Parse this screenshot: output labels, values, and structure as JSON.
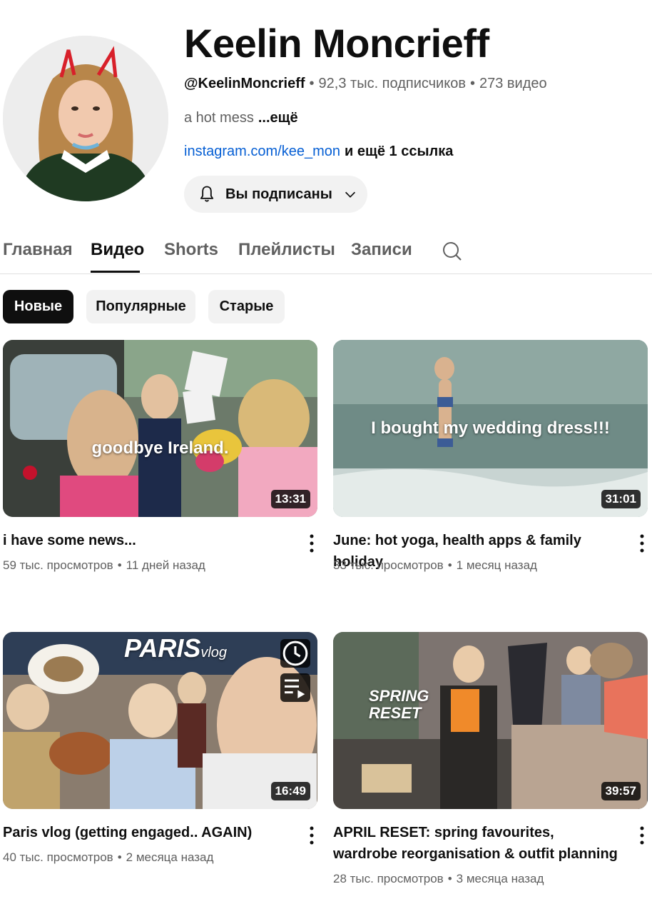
{
  "channel": {
    "name": "Keelin Moncrieff",
    "handle": "@KeelinMoncrieff",
    "subscribers": "92,3 тыс. подписчиков",
    "videos_count": "273 видео",
    "separator": "•",
    "description": "a hot mess",
    "description_more": "...ещё",
    "link": "instagram.com/kee_mon",
    "more_links": "и ещё 1 ссылка"
  },
  "subscribe_button": {
    "label": "Вы подписаны",
    "icon": "bell-icon"
  },
  "tabs": [
    {
      "label": "Главная",
      "active": false
    },
    {
      "label": "Видео",
      "active": true
    },
    {
      "label": "Shorts",
      "active": false
    },
    {
      "label": "Плейлисты",
      "active": false
    },
    {
      "label": "Записи",
      "active": false
    }
  ],
  "chips": [
    {
      "label": "Новые",
      "selected": true
    },
    {
      "label": "Популярные",
      "selected": false
    },
    {
      "label": "Старые",
      "selected": false
    }
  ],
  "videos": [
    {
      "title": "i have some news...",
      "views": "59 тыс. просмотров",
      "age": "11 дней назад",
      "duration": "13:31",
      "thumb_text": "goodbye Ireland."
    },
    {
      "title": "June: hot yoga, health apps & family holiday",
      "views": "33 тыс. просмотров",
      "age": "1 месяц назад",
      "duration": "31:01",
      "thumb_text": "I bought my wedding dress!!!"
    },
    {
      "title": "Paris vlog (getting engaged.. AGAIN)",
      "views": "40 тыс. просмотров",
      "age": "2 месяца назад",
      "duration": "16:49",
      "thumb_text": "PARIS",
      "thumb_text_small": "vlog"
    },
    {
      "title": "APRIL RESET: spring favourites, wardrobe reorganisation & outfit planning",
      "views": "28 тыс. просмотров",
      "age": "3 месяца назад",
      "duration": "39:57",
      "thumb_text": "SPRING RESET"
    }
  ],
  "colors": {
    "link": "#065fd4",
    "text_primary": "#0f0f0f",
    "text_secondary": "#606060",
    "chip_bg": "#f2f2f2"
  }
}
